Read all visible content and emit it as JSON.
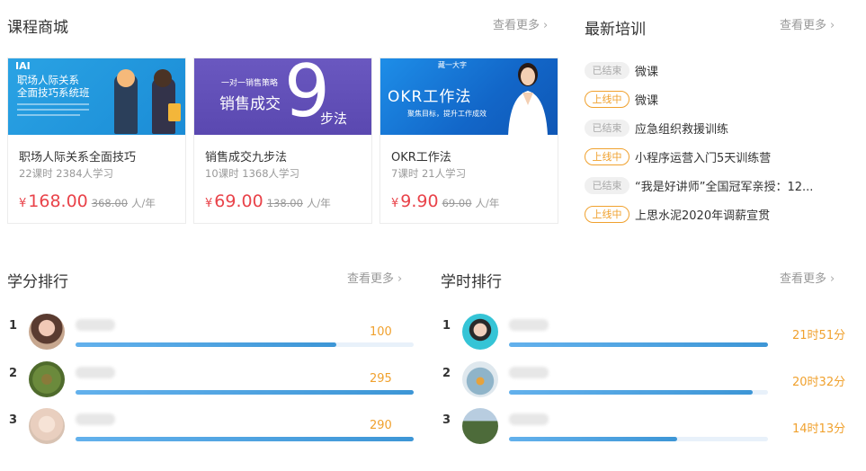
{
  "course_mall": {
    "title": "课程商城",
    "more": "查看更多",
    "courses": [
      {
        "cover_logo": "IAI",
        "cover_line1": "职场人际关系",
        "cover_line2": "全面技巧系统班",
        "title": "职场人际关系全面技巧",
        "meta": "22课时  2384人学习",
        "currency": "¥",
        "price": "168.00",
        "old_price": "368.00",
        "unit": "人/年"
      },
      {
        "cover_line1": "一对一销售策略",
        "cover_line2": "销售成交",
        "cover_nine": "9",
        "cover_line3": "步法",
        "title": "销售成交九步法",
        "meta": "10课时  1368人学习",
        "currency": "¥",
        "price": "69.00",
        "old_price": "138.00",
        "unit": "人/年"
      },
      {
        "cover_brand": "藏一大字",
        "cover_title": "OKR工作法",
        "cover_sub": "聚焦目标，提升工作成效",
        "title": "OKR工作法",
        "meta": "7课时  21人学习",
        "currency": "¥",
        "price": "9.90",
        "old_price": "69.00",
        "unit": "人/年"
      }
    ]
  },
  "training": {
    "title": "最新培训",
    "more": "查看更多",
    "items": [
      {
        "status": "已结束",
        "state": "ended",
        "text": "微课"
      },
      {
        "status": "上线中",
        "state": "online",
        "text": "微课"
      },
      {
        "status": "已结束",
        "state": "ended",
        "text": "应急组织救援训练"
      },
      {
        "status": "上线中",
        "state": "online",
        "text": "小程序运营入门5天训练营"
      },
      {
        "status": "已结束",
        "state": "ended",
        "text": "“我是好讲师”全国冠军亲授：12..."
      },
      {
        "status": "上线中",
        "state": "online",
        "text": "上思水泥2020年调薪宣贯"
      }
    ]
  },
  "credit_rank": {
    "title": "学分排行",
    "more": "查看更多",
    "rows": [
      {
        "rank": "1",
        "value": "100",
        "progress": 0.77
      },
      {
        "rank": "2",
        "value": "295",
        "progress": 1.0
      },
      {
        "rank": "3",
        "value": "290",
        "progress": 1.0
      }
    ]
  },
  "hours_rank": {
    "title": "学时排行",
    "more": "查看更多",
    "rows": [
      {
        "rank": "1",
        "value": "21时51分",
        "progress": 1.0
      },
      {
        "rank": "2",
        "value": "20时32分",
        "progress": 0.94
      },
      {
        "rank": "3",
        "value": "14时13分",
        "progress": 0.65
      }
    ]
  },
  "icons": {
    "more_chevron": "chevron-right-icon"
  },
  "colors": {
    "price": "#e9434a",
    "online_badge": "#f0a12e",
    "ended_badge": "#aaaaaa",
    "progress": "#3d96d6",
    "rank_value": "#f0a12e"
  }
}
